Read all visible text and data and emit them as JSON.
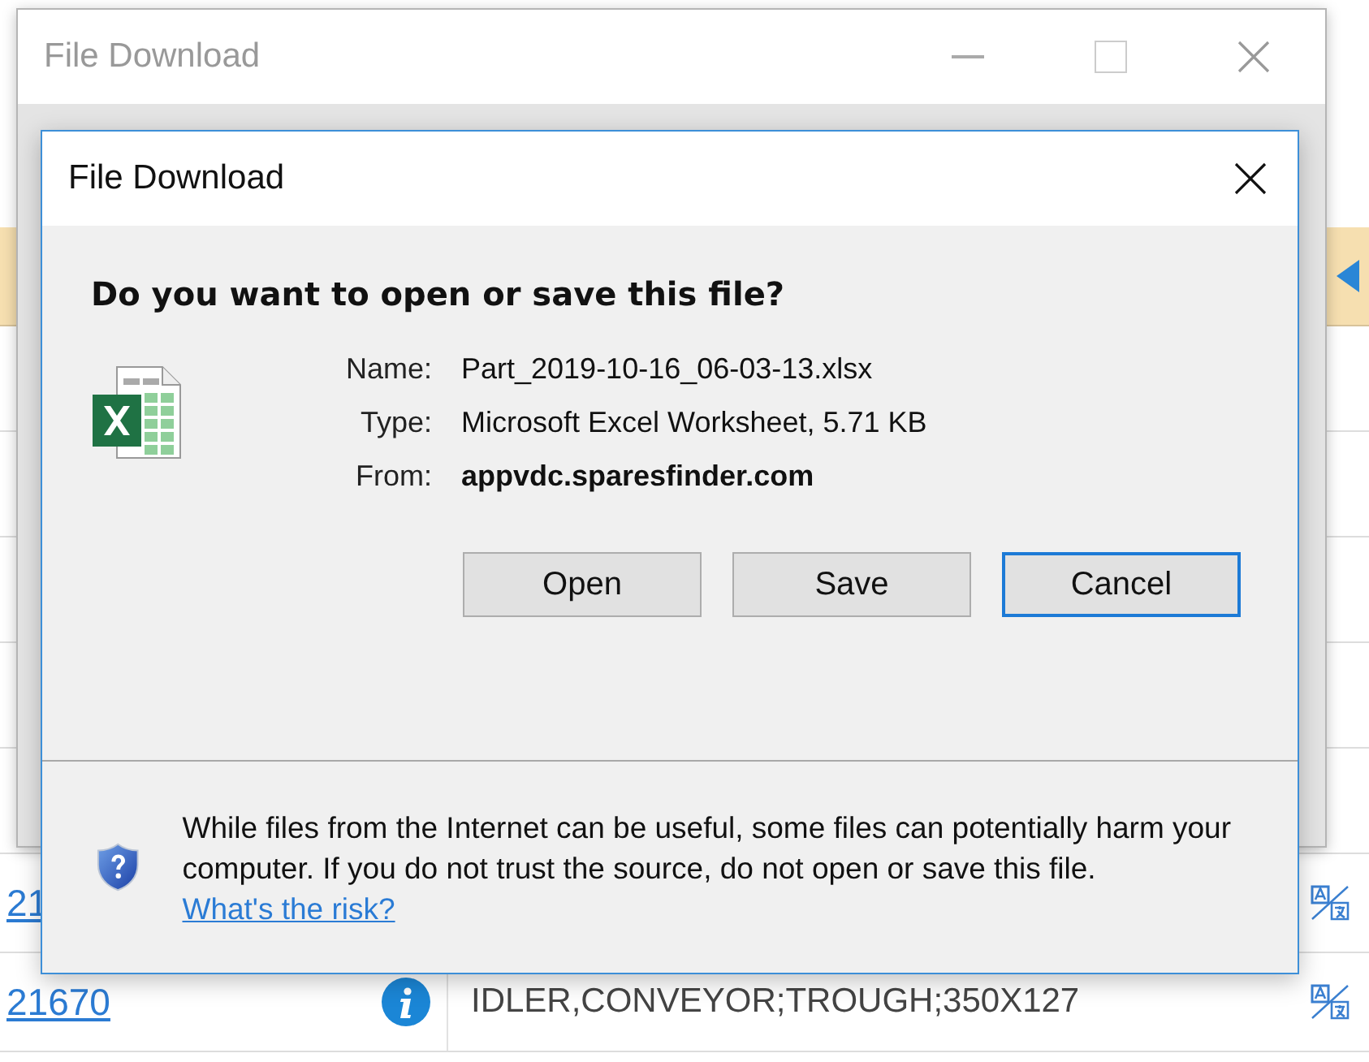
{
  "background_page": {
    "rows": [
      {
        "kind": "partial",
        "id": "21"
      },
      {
        "kind": "full",
        "id": "21670",
        "description": "IDLER,CONVEYOR;TROUGH;350X127"
      }
    ]
  },
  "back_window": {
    "title": "File Download"
  },
  "dialog": {
    "title": "File Download",
    "question": "Do you want to open or save this file?",
    "fields": [
      {
        "label": "Name:",
        "value": "Part_2019-10-16_06-03-13.xlsx",
        "bold": false
      },
      {
        "label": "Type:",
        "value": "Microsoft Excel Worksheet, 5.71 KB",
        "bold": false
      },
      {
        "label": "From:",
        "value": "appvdc.sparesfinder.com",
        "bold": true
      }
    ],
    "buttons": [
      {
        "label": "Open",
        "default": false
      },
      {
        "label": "Save",
        "default": false
      },
      {
        "label": "Cancel",
        "default": true
      }
    ],
    "warning": "While files from the Internet can be useful, some files can potentially harm your computer. If you do not trust the source, do not open or save this file.",
    "risk_link": "What's the risk?"
  }
}
